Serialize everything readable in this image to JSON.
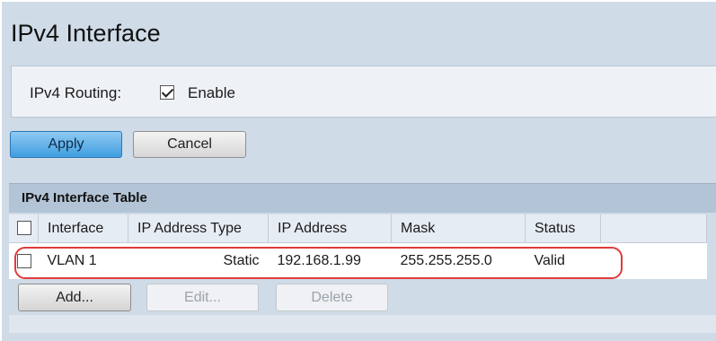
{
  "page": {
    "title": "IPv4 Interface"
  },
  "routing": {
    "label": "IPv4 Routing:",
    "enable_label": "Enable",
    "enabled": true
  },
  "actions": {
    "apply_label": "Apply",
    "cancel_label": "Cancel"
  },
  "table": {
    "title": "IPv4 Interface Table",
    "columns": [
      "Interface",
      "IP Address Type",
      "IP Address",
      "Mask",
      "Status"
    ],
    "rows": [
      {
        "interface": "VLAN 1",
        "ip_address_type": "Static",
        "ip_address": "192.168.1.99",
        "mask": "255.255.255.0",
        "status": "Valid",
        "selected": false
      }
    ],
    "buttons": {
      "add_label": "Add...",
      "edit_label": "Edit...",
      "delete_label": "Delete"
    }
  },
  "colors": {
    "panel": "#cfdbe7",
    "apply": "#3f9ee0",
    "highlight": "#e03b3b"
  }
}
